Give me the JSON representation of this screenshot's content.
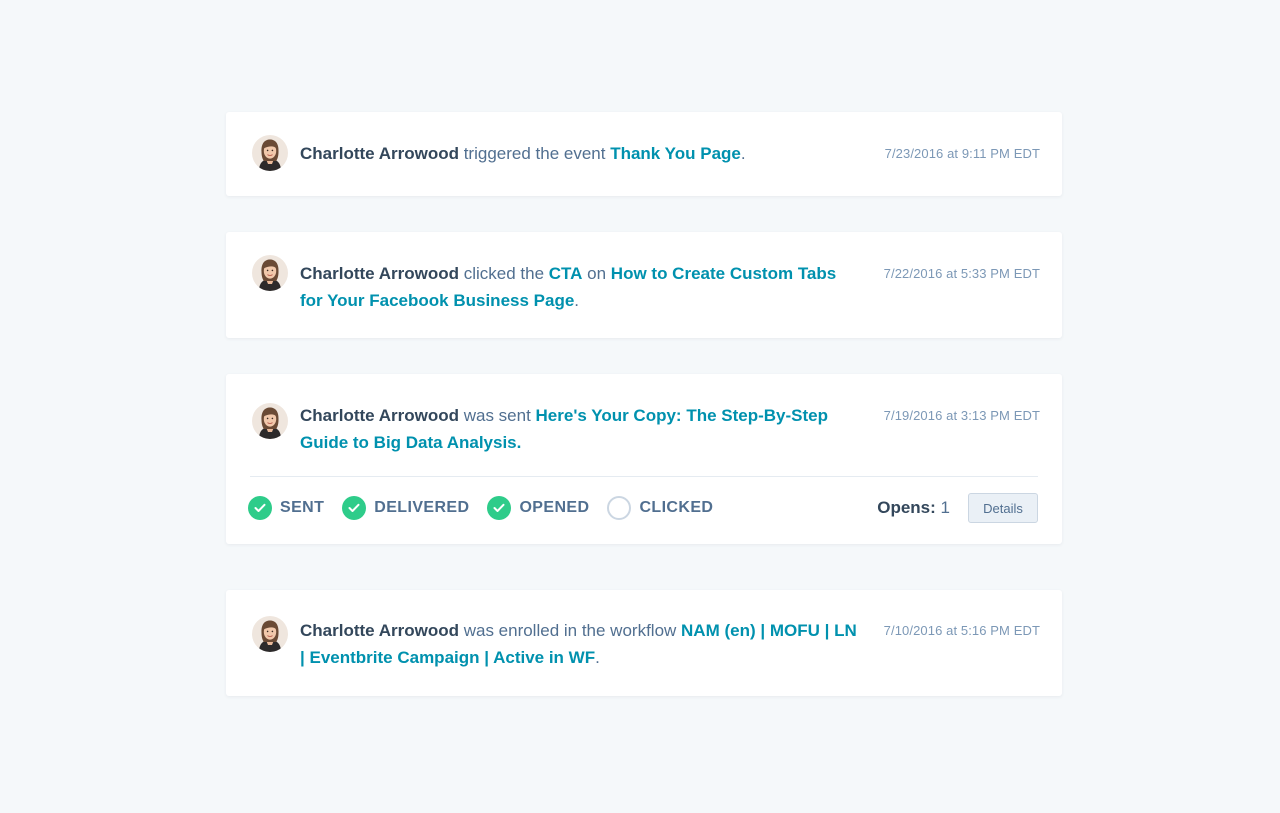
{
  "colors": {
    "background": "#f5f8fa",
    "card": "#ffffff",
    "name_text": "#33475b",
    "body_text": "#516f90",
    "link": "#0091ae",
    "timestamp": "#7c98b6",
    "status_complete": "#2ecc8a",
    "status_pending": "#cbd6e2"
  },
  "timeline": [
    {
      "avatar_icon": "contact-avatar",
      "name": "Charlotte Arrowood",
      "text1": " triggered the event ",
      "link1": "Thank You Page",
      "end": ".",
      "timestamp": "7/23/2016 at 9:11 PM EDT"
    },
    {
      "avatar_icon": "contact-avatar",
      "name": "Charlotte Arrowood",
      "text1": " clicked the ",
      "link1": "CTA",
      "text2": " on ",
      "link2": "How to Create Custom Tabs for Your Facebook Business Page",
      "end": ".",
      "timestamp": "7/22/2016 at 5:33 PM EDT"
    },
    {
      "avatar_icon": "contact-avatar",
      "name": "Charlotte Arrowood",
      "text1": " was sent ",
      "link1": "Here's Your Copy: The Step-By-Step Guide to Big Data Analysis.",
      "timestamp": "7/19/2016 at 3:13 PM EDT",
      "email_status": [
        {
          "label": "SENT",
          "done": true,
          "icon": "check-circle-icon"
        },
        {
          "label": "DELIVERED",
          "done": true,
          "icon": "check-circle-icon"
        },
        {
          "label": "OPENED",
          "done": true,
          "icon": "check-circle-icon"
        },
        {
          "label": "CLICKED",
          "done": false,
          "icon": "empty-circle-icon"
        }
      ],
      "opens_label": "Opens:",
      "opens_count": "1",
      "details_label": "Details"
    },
    {
      "avatar_icon": "contact-avatar",
      "name": "Charlotte Arrowood",
      "text1": " was enrolled in the workflow ",
      "link1": "NAM (en) | MOFU | LN | Eventbrite Campaign | Active in WF",
      "end": ".",
      "timestamp": "7/10/2016 at 5:16 PM EDT"
    }
  ]
}
